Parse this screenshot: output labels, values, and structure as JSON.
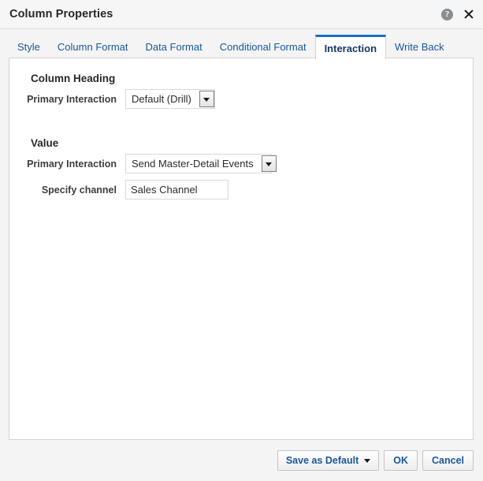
{
  "titlebar": {
    "title": "Column Properties",
    "help_icon": "help-icon",
    "close_icon": "close-icon"
  },
  "tabs": [
    {
      "label": "Style",
      "active": false
    },
    {
      "label": "Column Format",
      "active": false
    },
    {
      "label": "Data Format",
      "active": false
    },
    {
      "label": "Conditional Format",
      "active": false
    },
    {
      "label": "Interaction",
      "active": true
    },
    {
      "label": "Write Back",
      "active": false
    }
  ],
  "sections": [
    {
      "title": "Column Heading",
      "fields": [
        {
          "label": "Primary Interaction",
          "type": "select",
          "value": "Default (Drill)"
        }
      ]
    },
    {
      "title": "Value",
      "fields": [
        {
          "label": "Primary Interaction",
          "type": "select",
          "value": "Send Master-Detail Events"
        },
        {
          "label": "Specify channel",
          "type": "text",
          "value": "Sales Channel",
          "placeholder": ""
        }
      ]
    }
  ],
  "footer": {
    "save_as_default": "Save as Default",
    "ok": "OK",
    "cancel": "Cancel"
  },
  "colors": {
    "accent": "#1672c4",
    "link": "#19599c",
    "active_tab_text": "#133a63",
    "title_text": "#26292b",
    "panel_bg": "#ffffff",
    "dialog_bg": "#f4f4f4"
  }
}
